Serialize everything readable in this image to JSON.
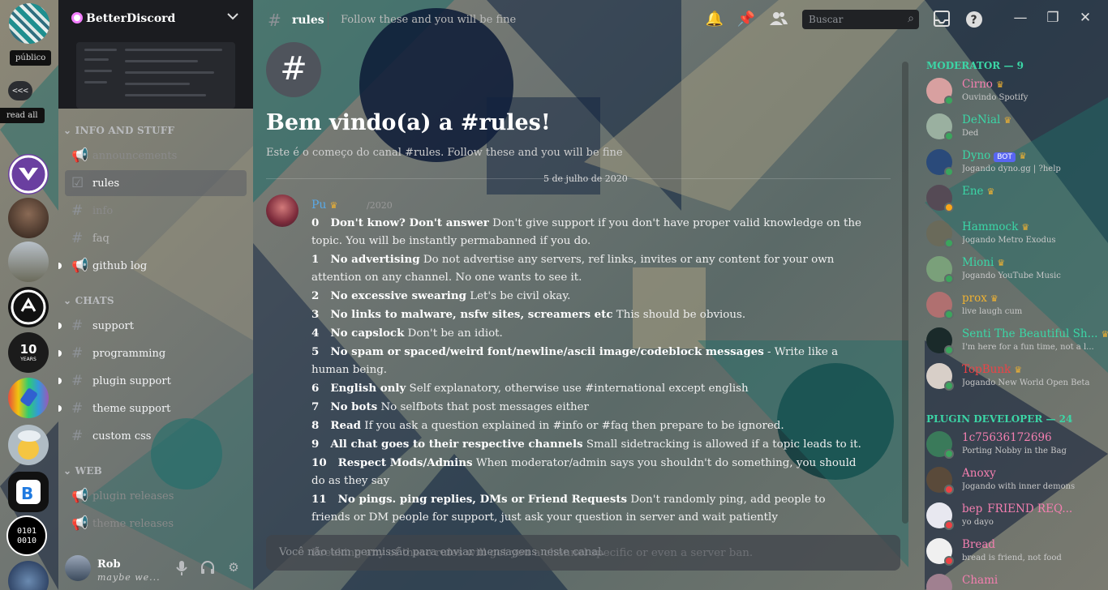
{
  "servers": {
    "tooltip_public": "público",
    "collapse_label": "<<<",
    "read_all": "read all",
    "items": [
      {
        "name": "server-mauve",
        "color": "#6a3fa0"
      },
      {
        "name": "server-portrait",
        "color": "#4a3326"
      },
      {
        "name": "server-landscape",
        "color": "#8a8a7a"
      },
      {
        "name": "server-logo-white",
        "color": "#222222"
      },
      {
        "name": "server-10-years",
        "color": "#1b1b1b"
      },
      {
        "name": "server-plug",
        "color": "#c24cd4"
      },
      {
        "name": "server-emoji",
        "color": "#9aa6b0"
      },
      {
        "name": "server-bd",
        "color": "#1f2a38"
      },
      {
        "name": "server-binary",
        "color": "#000000"
      },
      {
        "name": "server-blue",
        "color": "#2a4a7a"
      }
    ],
    "binary_text": [
      "0101",
      "0010"
    ],
    "ten_years": "10",
    "years_label": "YEARS"
  },
  "guild": {
    "name": "BetterDiscord"
  },
  "categories": [
    {
      "label": "INFO AND STUFF"
    },
    {
      "label": "CHATS"
    },
    {
      "label": "WEB"
    }
  ],
  "channels": {
    "info": [
      {
        "label": "announcements",
        "icon": "announcement-icon"
      },
      {
        "label": "rules",
        "icon": "rules-icon"
      },
      {
        "label": "info",
        "icon": "text-channel-icon"
      },
      {
        "label": "faq",
        "icon": "text-channel-icon"
      },
      {
        "label": "github log",
        "icon": "announcement-icon"
      }
    ],
    "chats": [
      {
        "label": "support"
      },
      {
        "label": "programming"
      },
      {
        "label": "plugin support"
      },
      {
        "label": "theme support"
      },
      {
        "label": "custom css"
      }
    ],
    "web": [
      {
        "label": "plugin releases"
      },
      {
        "label": "theme releases"
      }
    ]
  },
  "user": {
    "name": "Rob",
    "status": "maybe we..."
  },
  "topbar": {
    "channel": "rules",
    "topic": "Follow these and you will be fine",
    "search_placeholder": "Buscar"
  },
  "welcome": {
    "title": "Bem vindo(a) a #rules!",
    "subtitle": "Este é o começo do canal #rules. Follow these and you will be fine",
    "date": "5 de julho de 2020"
  },
  "message": {
    "author": "Pu",
    "time": "/2020",
    "rules": [
      {
        "n": "0",
        "t": "Don't know? Don't answer",
        "d": "Don't give support if you don't have proper valid knowledge on the topic. You will be instantly permabanned if you do."
      },
      {
        "n": "1",
        "t": "No advertising",
        "d": "Do not advertise any servers, ref links, invites or any content for your own attention on any channel. No one wants to see it."
      },
      {
        "n": "2",
        "t": "No excessive swearing",
        "d": "Let's be civil okay."
      },
      {
        "n": "3",
        "t": "No links to malware, nsfw sites, screamers etc",
        "d": "This should be obvious."
      },
      {
        "n": "4",
        "t": "No capslock",
        "d": "Don't be an idiot."
      },
      {
        "n": "5",
        "t": "No spam or spaced/weird font/newline/ascii image/codeblock messages",
        "d": "- Write like a human being."
      },
      {
        "n": "6",
        "t": "English only",
        "d": "Self explanatory, otherwise use #international except english"
      },
      {
        "n": "7",
        "t": "No bots",
        "d": "No selfbots that post messages either"
      },
      {
        "n": "8",
        "t": "Read",
        "d": "If you ask a question explained in #info or #faq then prepare to be ignored."
      },
      {
        "n": "9",
        "t": "All chat goes to their respective channels",
        "d": "Small sidetracking is allowed if a topic leads to it."
      },
      {
        "n": "10",
        "t": "Respect Mods/Admins",
        "d": "When moderator/admin says you shouldn't do something, you should do as they say"
      },
      {
        "n": "11",
        "t": "No pings. ping replies, DMs or Friend Requests",
        "d": "Don't randomly ping, add people to friends or DM people for support, just ask your question in server and wait patiently"
      }
    ],
    "footer": "Breaking any of these rules will get you a channel specific or even a server ban."
  },
  "composer": {
    "placeholder": "Você não tem permissão para enviar mensagens neste canal."
  },
  "members": {
    "moderator_header": "MODERATOR — 9",
    "plugin_dev_header": "PLUGIN DEVELOPER — 24",
    "moderators": [
      {
        "name": "Cirno",
        "color": "#f47fb0",
        "activity": "Ouvindo Spotify",
        "status": "#3ba55d",
        "crown": true,
        "av": "#d8a0a0"
      },
      {
        "name": "DeNial",
        "color": "#3bd6a6",
        "activity": "Ded",
        "status": "#3ba55d",
        "crown": true,
        "av": "#9ab0a0"
      },
      {
        "name": "Dyno",
        "color": "#3bd6a6",
        "activity": "Jogando dyno.gg | ?help",
        "status": "#3ba55d",
        "crown": true,
        "bot": "BOT",
        "av": "#2a4a7a"
      },
      {
        "name": "Ene",
        "color": "#3bd6a6",
        "activity": "",
        "status": "#faa61a",
        "crown": true,
        "av": "#554a55"
      },
      {
        "name": "Hammock",
        "color": "#3bd6a6",
        "activity": "Jogando Metro Exodus",
        "status": "#3ba55d",
        "crown": true,
        "av": "#6a6a5a"
      },
      {
        "name": "Mioni",
        "color": "#3bd6a6",
        "activity": "Jogando YouTube Music",
        "status": "#3ba55d",
        "crown": true,
        "av": "#7aa07a"
      },
      {
        "name": "prox",
        "color": "#f0b232",
        "activity": "live laugh cum",
        "status": "#3ba55d",
        "crown": true,
        "av": "#b07070"
      },
      {
        "name": "Senti The Beautiful Sh...",
        "color": "#3bd6a6",
        "activity": "I'm here for a fun time, not a l...",
        "status": "#3ba55d",
        "crown": true,
        "av": "#1a2a2a"
      },
      {
        "name": "TopBunk",
        "color": "#ed4245",
        "activity": "Jogando New World Open Beta",
        "status": "#3ba55d",
        "crown": true,
        "av": "#d8cfc8"
      }
    ],
    "plugin_devs": [
      {
        "name": "1c75636172696",
        "color": "#f47fb0",
        "activity": "Porting Nobby in the Bag",
        "status": "#3ba55d",
        "av": "#3a7a5a"
      },
      {
        "name": "Anoxy",
        "color": "#f47fb0",
        "activity": "Jogando with inner demons",
        "status": "#ed4245",
        "av": "#5a4a3a"
      },
      {
        "name": "bep",
        "color": "#f47fb0",
        "activity": "yo dayo",
        "status": "#ed4245",
        "extra": "FRIEND REQ...",
        "av": "#e8e8f0"
      },
      {
        "name": "Bread",
        "color": "#f47fb0",
        "activity": "bread is friend, not food",
        "status": "#ed4245",
        "av": "#f0f0f0"
      },
      {
        "name": "Chami",
        "color": "#f47fb0",
        "activity": "",
        "status": "#3ba55d",
        "av": "#a08090"
      }
    ]
  }
}
